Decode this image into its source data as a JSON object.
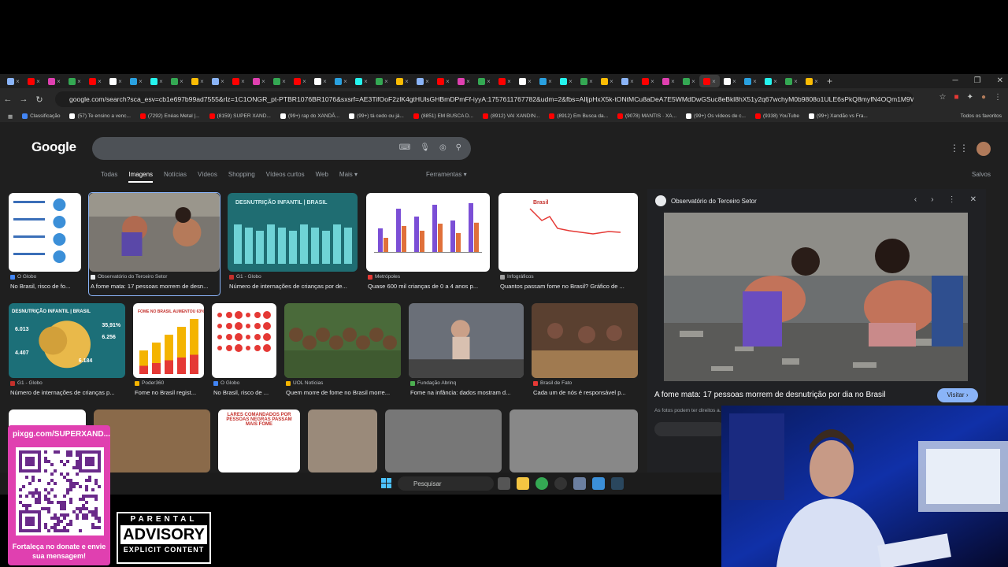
{
  "browser": {
    "url": "google.com/search?sca_esv=cb1e697b99ad7555&rlz=1C1ONGR_pt-PTBR1076BR1076&sxsrf=AE3TifOoF2zlK4gtHUlsGHBmDPmFf-iyyA:1757611767782&udm=2&fbs=AIljpHxX5k-tONtMCu8aDeA7E5WMdDwGSuc8eBkl8hX51y2q67wchyM0b9808o1ULE6sPkQ8myfN4OQm1M9WkEQ-djvv7VtE81NVEDyzM...",
    "tab_count": 40,
    "bookmarks": [
      {
        "label": "Classificação",
        "color": "#4285f4"
      },
      {
        "label": "(57) Te ensino a venc...",
        "color": "#ffffff"
      },
      {
        "label": "(7292) Enéas Metal |...",
        "color": "#ff0000"
      },
      {
        "label": "(8159) SUPER XAND...",
        "color": "#ff0000"
      },
      {
        "label": "(99+) rap do XANDÃ...",
        "color": "#ffffff"
      },
      {
        "label": "(99+) tá cedo ou já...",
        "color": "#ffffff"
      },
      {
        "label": "(8851) EM BUSCA D...",
        "color": "#ff0000"
      },
      {
        "label": "(8912) VAI XANDIN...",
        "color": "#ff0000"
      },
      {
        "label": "(8912) Em Busca da...",
        "color": "#ff0000"
      },
      {
        "label": "(9078) MANTIS · XA...",
        "color": "#ff0000"
      },
      {
        "label": "(99+) Os vídeos de c...",
        "color": "#ffffff"
      },
      {
        "label": "(9338) YouTube",
        "color": "#ff0000"
      },
      {
        "label": "(99+) Xandão vs Fra...",
        "color": "#ffffff"
      }
    ],
    "all_bookmarks": "Todos os favoritos"
  },
  "google": {
    "logo": "Google",
    "tabs": [
      "Todas",
      "Imagens",
      "Notícias",
      "Vídeos",
      "Shopping",
      "Vídeos curtos",
      "Web",
      "Mais ▾"
    ],
    "tools": "Ferramentas ▾",
    "saved": "Salvos"
  },
  "results": [
    {
      "source": "O Globo",
      "caption": "No Brasil, risco de fo...",
      "color": "#4285f4"
    },
    {
      "source": "Observatório do Terceiro Setor",
      "caption": "A fome mata: 17 pessoas morrem de desn...",
      "color": "#e8eaed"
    },
    {
      "source": "G1 - Globo",
      "caption": "Número de internações de crianças por de...",
      "color": "#c4302b"
    },
    {
      "source": "Metrópoles",
      "caption": "Quase 600 mil crianças de 0 a 4 anos p...",
      "color": "#e53935"
    },
    {
      "source": "Infográficos",
      "caption": "Quantos passam fome no Brasil? Gráfico de ...",
      "color": "#9e9e9e"
    },
    {
      "source": "G1 - Globo",
      "caption": "Número de internações de crianças p...",
      "color": "#c4302b"
    },
    {
      "source": "Poder360",
      "caption": "Fome no Brasil regist...",
      "color": "#f4b400"
    },
    {
      "source": "O Globo",
      "caption": "No Brasil, risco de ...",
      "color": "#4285f4"
    },
    {
      "source": "UOL Notícias",
      "caption": "Quem morre de fome no Brasil morre...",
      "color": "#f4b400"
    },
    {
      "source": "Fundação Abrinq",
      "caption": "Fome na infância: dados mostram d...",
      "color": "#4caf50"
    },
    {
      "source": "Brasil de Fato",
      "caption": "Cada um de nós é responsável p...",
      "color": "#e53935"
    }
  ],
  "thumb_texts": {
    "desnutricao": "DESNUTRIÇÃO INFANTIL | BRASIL",
    "brasil": "Brasil",
    "fome_aumentou": "FOME NO BRASIL AUMENTOU 63% EM 17 ANOS",
    "lares": "LARES COMANDADOS POR PESSOAS NEGRAS PASSAM MAIS FOME",
    "map_pct1": "35,91%",
    "map_pct2": "6.256",
    "map_pct3": "6.013",
    "map_pct4": "4.407",
    "map_pct5": "6.184"
  },
  "panel": {
    "site": "Observatório do Terceiro Setor",
    "title": "A fome mata: 17 pessoas morrem de desnutrição por dia no Brasil",
    "visit": "Visitar ›",
    "note": "As fotos podem ter direitos a..."
  },
  "taskbar": {
    "search": "Pesquisar"
  },
  "overlay": {
    "qr_url": "pixgg.com/SUPERXAND...",
    "qr_message": "Fortaleça no donate e envie sua mensagem!",
    "advisory_top": "PARENTAL",
    "advisory_mid": "ADVISORY",
    "advisory_bottom": "EXPLICIT CONTENT"
  }
}
